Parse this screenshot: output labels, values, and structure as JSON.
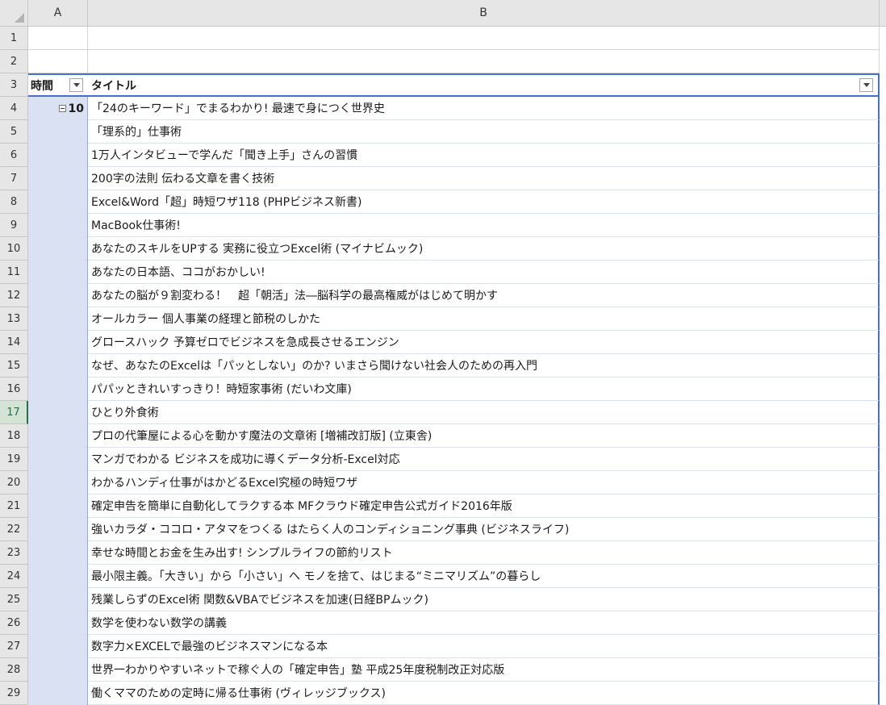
{
  "columns": [
    "A",
    "B"
  ],
  "header_row": {
    "row": "3",
    "time_label": "時間",
    "title_label": "タイトル"
  },
  "empty_rows": [
    "1",
    "2"
  ],
  "group": {
    "row": "4",
    "time_value": "10"
  },
  "selected_row": "17",
  "titles": [
    {
      "row": "4",
      "text": "「24のキーワード」でまるわかり! 最速で身につく世界史"
    },
    {
      "row": "5",
      "text": "「理系的」仕事術"
    },
    {
      "row": "6",
      "text": "1万人インタビューで学んだ「聞き上手」さんの習慣"
    },
    {
      "row": "7",
      "text": "200字の法則 伝わる文章を書く技術"
    },
    {
      "row": "8",
      "text": "Excel&Word「超」時短ワザ118 (PHPビジネス新書)"
    },
    {
      "row": "9",
      "text": "MacBook仕事術!"
    },
    {
      "row": "10",
      "text": "あなたのスキルをUPする 実務に役立つExcel術 (マイナビムック)"
    },
    {
      "row": "11",
      "text": "あなたの日本語、ココがおかしい!"
    },
    {
      "row": "12",
      "text": "あなたの脳が９割変わる！　超「朝活」法―脳科学の最高権威がはじめて明かす"
    },
    {
      "row": "13",
      "text": "オールカラー 個人事業の経理と節税のしかた"
    },
    {
      "row": "14",
      "text": "グロースハック 予算ゼロでビジネスを急成長させるエンジン"
    },
    {
      "row": "15",
      "text": "なぜ、あなたのExcelは「パッとしない」のか? いまさら聞けない社会人のための再入門"
    },
    {
      "row": "16",
      "text": "パパッときれいすっきり！時短家事術 (だいわ文庫)"
    },
    {
      "row": "17",
      "text": "ひとり外食術"
    },
    {
      "row": "18",
      "text": "プロの代筆屋による心を動かす魔法の文章術 [増補改訂版] (立東舎)"
    },
    {
      "row": "19",
      "text": "マンガでわかる ビジネスを成功に導くデータ分析-Excel対応"
    },
    {
      "row": "20",
      "text": "わかるハンディ仕事がはかどるExcel究極の時短ワザ"
    },
    {
      "row": "21",
      "text": "確定申告を簡単に自動化してラクする本 MFクラウド確定申告公式ガイド2016年版"
    },
    {
      "row": "22",
      "text": "強いカラダ・ココロ・アタマをつくる はたらく人のコンディショニング事典 (ビジネスライフ)"
    },
    {
      "row": "23",
      "text": "幸せな時間とお金を生み出す! シンプルライフの節約リスト"
    },
    {
      "row": "24",
      "text": "最小限主義。「大きい」から「小さい」へ モノを捨て、はじまる“ミニマリズム”の暮らし"
    },
    {
      "row": "25",
      "text": "残業しらずのExcel術 関数&VBAでビジネスを加速(日経BPムック)"
    },
    {
      "row": "26",
      "text": "数学を使わない数学の講義"
    },
    {
      "row": "27",
      "text": "数字力×EXCELで最強のビジネスマンになる本"
    },
    {
      "row": "28",
      "text": "世界一わかりやすいネットで稼ぐ人の「確定申告」塾 平成25年度税制改正対応版"
    },
    {
      "row": "29",
      "text": "働くママのための定時に帰る仕事術 (ヴィレッジブックス)"
    }
  ],
  "colors": {
    "pivot_border": "#4472c4",
    "pivot_fill": "#d9e1f2",
    "selected_row": "#217346"
  }
}
